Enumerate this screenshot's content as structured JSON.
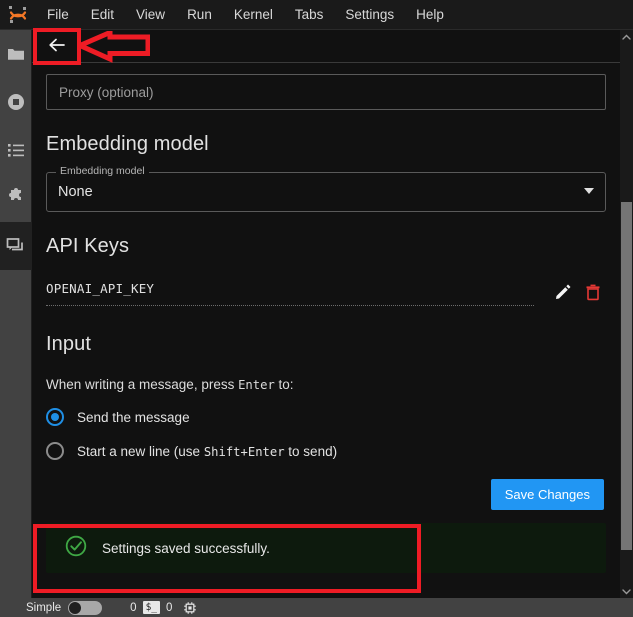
{
  "app": {
    "logo_icon": "jupyter-logo-icon"
  },
  "menubar": {
    "items": [
      {
        "label": "File"
      },
      {
        "label": "Edit"
      },
      {
        "label": "View"
      },
      {
        "label": "Run"
      },
      {
        "label": "Kernel"
      },
      {
        "label": "Tabs"
      },
      {
        "label": "Settings"
      },
      {
        "label": "Help"
      }
    ]
  },
  "activitybar": {
    "items": [
      {
        "name": "file-browser",
        "icon": "folder-icon",
        "selected": false
      },
      {
        "name": "running-terminals-kernels",
        "icon": "stop-circle-icon",
        "selected": false
      },
      {
        "name": "table-of-contents",
        "icon": "list-icon",
        "selected": false
      },
      {
        "name": "extension-manager",
        "icon": "puzzle-piece-icon",
        "selected": false
      },
      {
        "name": "chat-panel",
        "icon": "chat-bubbles-icon",
        "selected": true
      }
    ]
  },
  "toolbar": {
    "back_label": "back-arrow-icon"
  },
  "settings": {
    "proxy": {
      "value": "",
      "placeholder": "Proxy (optional)"
    },
    "embedding": {
      "heading": "Embedding model",
      "legend": "Embedding model",
      "value": "None",
      "options": [
        "None"
      ]
    },
    "api_keys": {
      "heading": "API Keys",
      "rows": [
        {
          "name": "OPENAI_API_KEY"
        }
      ],
      "edit_icon": "pencil-icon",
      "delete_icon": "trash-icon"
    },
    "input": {
      "heading": "Input",
      "hint_before": "When writing a message, press ",
      "hint_key": "Enter",
      "hint_after": " to:",
      "options": [
        {
          "label": "Send the message",
          "checked": true
        },
        {
          "label_before": "Start a new line (use ",
          "label_key": "Shift+Enter",
          "label_after": " to send)",
          "checked": false
        }
      ]
    },
    "save_label": "Save Changes",
    "alert": {
      "text": "Settings saved successfully.",
      "icon": "check-circle-icon",
      "color": "#3fa845"
    }
  },
  "scrollbar": {
    "up_icon": "chevron-up-icon",
    "down_icon": "chevron-down-icon"
  },
  "statusbar": {
    "mode_label": "Simple",
    "terminals_count": "0",
    "terminal_icon": "terminal-icon",
    "terminal_glyph": "$_",
    "kernels_count": "0",
    "kernel_icon": "kernel-chip-icon"
  },
  "annotations": {
    "highlight_color": "#ee1c25",
    "boxes": [
      "back-button-highlight",
      "success-alert-highlight"
    ],
    "arrows": [
      "pointer-arrow-to-back-button"
    ]
  }
}
